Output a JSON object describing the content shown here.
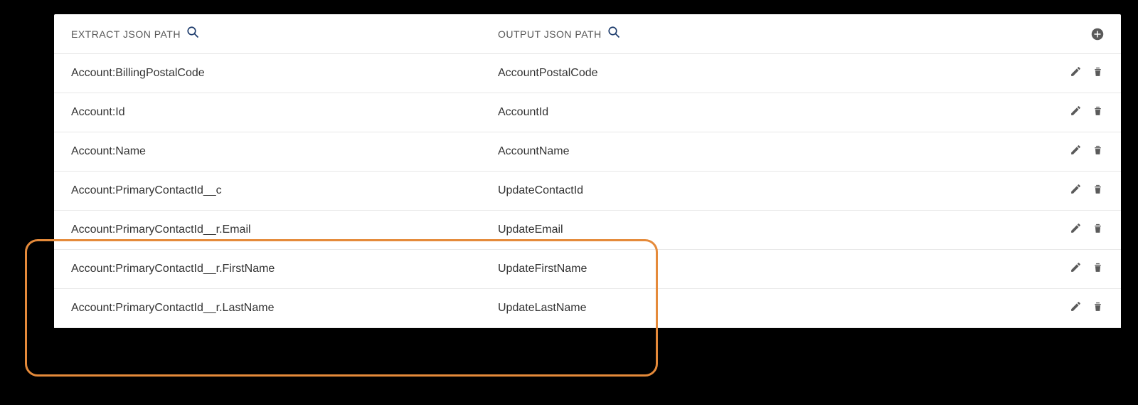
{
  "headers": {
    "extract": "EXTRACT JSON PATH",
    "output": "OUTPUT JSON PATH"
  },
  "rows": [
    {
      "extract": "Account:BillingPostalCode",
      "output": "AccountPostalCode"
    },
    {
      "extract": "Account:Id",
      "output": "AccountId"
    },
    {
      "extract": "Account:Name",
      "output": "AccountName"
    },
    {
      "extract": "Account:PrimaryContactId__c",
      "output": "UpdateContactId"
    },
    {
      "extract": "Account:PrimaryContactId__r.Email",
      "output": "UpdateEmail"
    },
    {
      "extract": "Account:PrimaryContactId__r.FirstName",
      "output": "UpdateFirstName"
    },
    {
      "extract": "Account:PrimaryContactId__r.LastName",
      "output": "UpdateLastName"
    }
  ]
}
